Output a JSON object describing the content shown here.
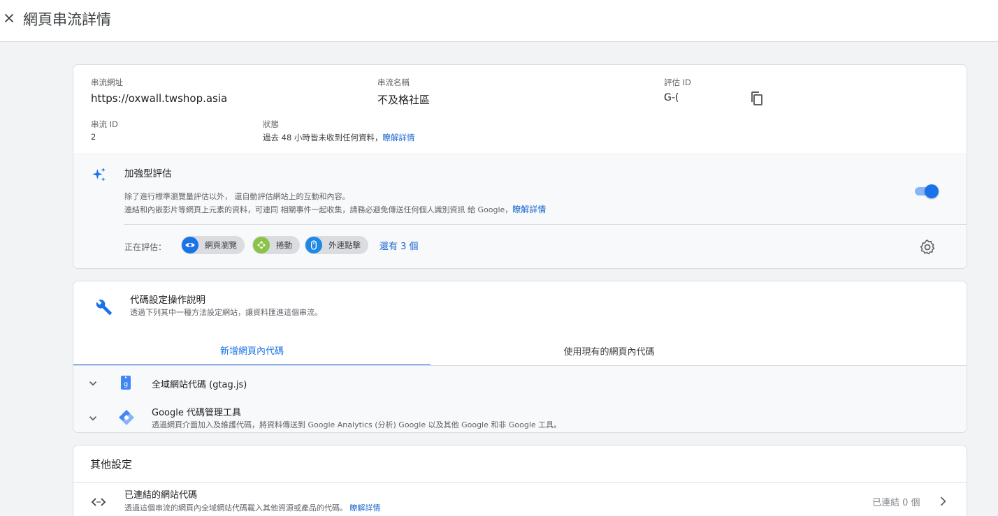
{
  "header": {
    "title": "網頁串流詳情",
    "close_icon": "close-icon"
  },
  "stream": {
    "url_label": "串流網址",
    "url_value": "https://oxwall.twshop.asia",
    "name_label": "串流名稱",
    "name_value": "不及格社區",
    "measure_label": "評估 ID",
    "measure_value": "G-(",
    "id_label": "串流 ID",
    "id_value": "2",
    "status_label": "狀態",
    "status_value": "過去 48 小時皆未收到任何資料，",
    "status_link": "瞭解詳情"
  },
  "enhanced": {
    "title": "加強型評估",
    "desc1": "除了進行標準瀏覽量評估以外， 還自動評估網站上的互動和內容。",
    "desc2": "連結和內嵌影片等網頁上元素的資料，可連同 相關事件一起收集，請務必避免傳送任何個人識別資訊 給 Google，",
    "desc_link": "瞭解詳情",
    "toggle_on": true,
    "measuring_label": "正在評估：",
    "chips": [
      {
        "label": "網頁瀏覽",
        "icon": "eye-icon",
        "color": "#1a73e8"
      },
      {
        "label": "捲動",
        "icon": "scroll-arrows-icon",
        "color": "#8bc34a"
      },
      {
        "label": "外連點擊",
        "icon": "mouse-icon",
        "color": "#1e88e5"
      }
    ],
    "more_link": "還有 3 個"
  },
  "tagging": {
    "title": "代碼設定操作說明",
    "subtitle": "透過下列其中一種方法設定網站，讓資料匯進這個串流。",
    "tabs": [
      {
        "label": "新增網頁內代碼",
        "active": true
      },
      {
        "label": "使用現有的網頁內代碼",
        "active": false
      }
    ],
    "options": [
      {
        "title": "全域網站代碼 (gtag.js)",
        "desc": "",
        "icon": "gtag-icon"
      },
      {
        "title": "Google 代碼管理工具",
        "desc": "透過網頁介面加入及維護代碼，將資料傳送到 Google Analytics (分析) Google 以及其他 Google 和非 Google 工具。",
        "icon": "tag-manager-icon"
      }
    ]
  },
  "other": {
    "title": "其他設定",
    "item_title": "已連結的網站代碼",
    "item_desc": "透過這個串流的網頁內全域網站代碼載入其他資源或產品的代碼。",
    "item_link": "瞭解詳情",
    "item_count": "已連結 0 個"
  },
  "colors": {
    "accent": "#1a73e8",
    "link": "#1967d2"
  }
}
